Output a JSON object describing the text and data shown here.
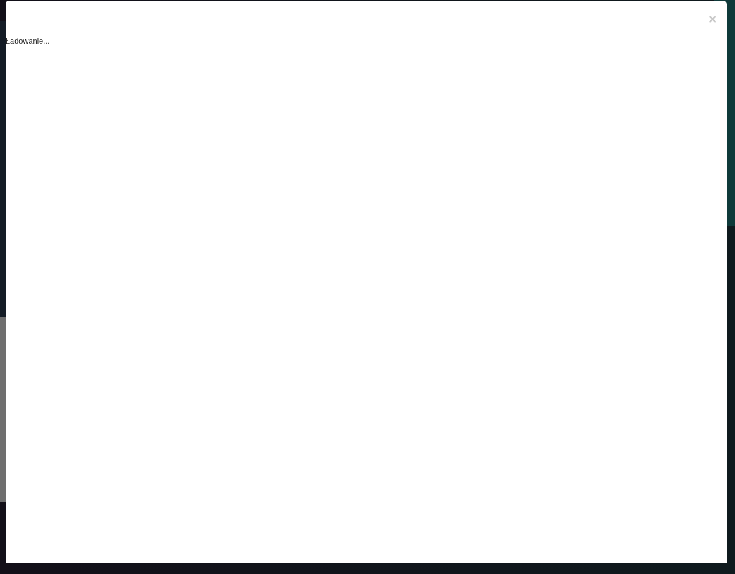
{
  "modal": {
    "close": "×",
    "status": "Ładowanie..."
  }
}
